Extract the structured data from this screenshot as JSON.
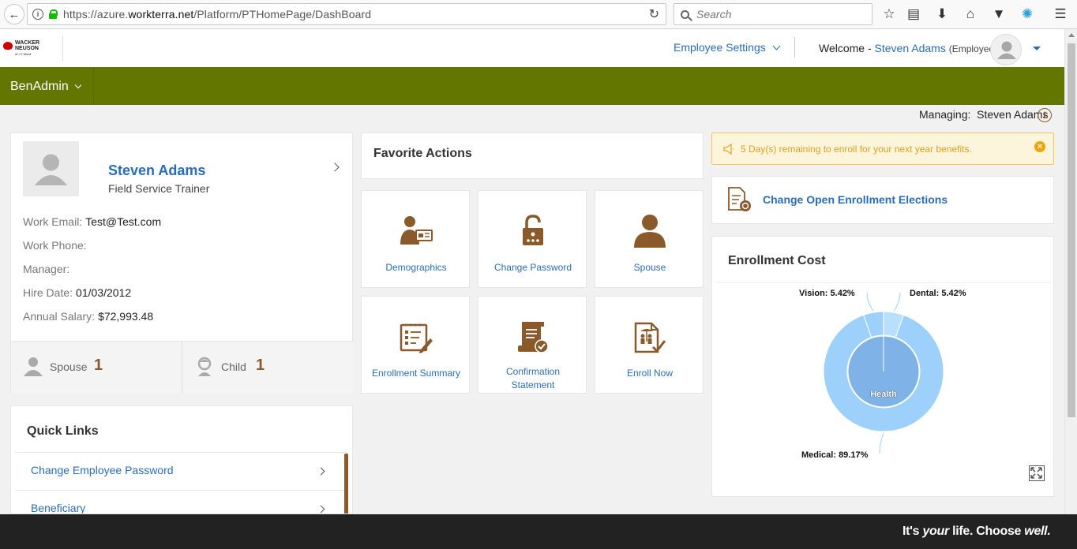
{
  "browser": {
    "url_prefix": "https://azure.",
    "url_domain": "workterra.net",
    "url_path": "/Platform/PTHomePage/DashBoard",
    "search_placeholder": "Search"
  },
  "header": {
    "logo_text_line1": "WACKER",
    "logo_text_line2": "NEUSON",
    "logo_text_line3": "of J.T.Mindl",
    "employee_settings": "Employee Settings",
    "welcome_prefix": "Welcome -",
    "user_name": "Steven Adams",
    "user_role": "(Employee)"
  },
  "nav": {
    "module": "BenAdmin"
  },
  "managing": {
    "label": "Managing:",
    "name": "Steven Adams"
  },
  "profile": {
    "name": "Steven Adams",
    "title": "Field Service Trainer",
    "fields": [
      {
        "label": "Work Email:",
        "value": "Test@Test.com"
      },
      {
        "label": "Work Phone:",
        "value": ""
      },
      {
        "label": "Manager:",
        "value": ""
      },
      {
        "label": "Hire Date:",
        "value": "01/03/2012"
      },
      {
        "label": "Annual Salary:",
        "value": "$72,993.48"
      }
    ],
    "dependents": [
      {
        "label": "Spouse",
        "count": "1"
      },
      {
        "label": "Child",
        "count": "1"
      }
    ]
  },
  "quick_links": {
    "title": "Quick Links",
    "items": [
      "Change Employee Password",
      "Beneficiary"
    ]
  },
  "favorite_actions": {
    "title": "Favorite Actions",
    "tiles": [
      {
        "label": "Demographics"
      },
      {
        "label": "Change Password"
      },
      {
        "label": "Spouse"
      },
      {
        "label": "Enrollment Summary"
      },
      {
        "label_line1": "Confirmation",
        "label_line2": "Statement"
      },
      {
        "label": "Enroll Now"
      }
    ]
  },
  "alert": {
    "text": "5 Day(s) remaining to enroll for your next year benefits.",
    "close": "×"
  },
  "open_enrollment": {
    "link": "Change Open Enrollment Elections"
  },
  "enrollment_cost": {
    "title": "Enrollment Cost"
  },
  "chart_data": {
    "type": "pie",
    "title": "Enrollment Cost",
    "inner_label": "Health",
    "slices": [
      {
        "name": "Medical",
        "value": 89.17,
        "label": "Medical: 89.17%",
        "color": "#9dd1fb"
      },
      {
        "name": "Vision",
        "value": 5.42,
        "label": "Vision: 5.42%",
        "color": "#9dd1fb"
      },
      {
        "name": "Dental",
        "value": 5.42,
        "label": "Dental: 5.42%",
        "color": "#b8e0fd"
      }
    ],
    "inner_color": "#7fb3e8"
  },
  "footer": {
    "tag_1": "It's ",
    "tag_2": "your",
    "tag_3": " life. Choose ",
    "tag_4": "well."
  },
  "colors": {
    "brand_green": "#637700",
    "link_blue": "#2a6db5",
    "accent_brown": "#8a5a2b"
  }
}
